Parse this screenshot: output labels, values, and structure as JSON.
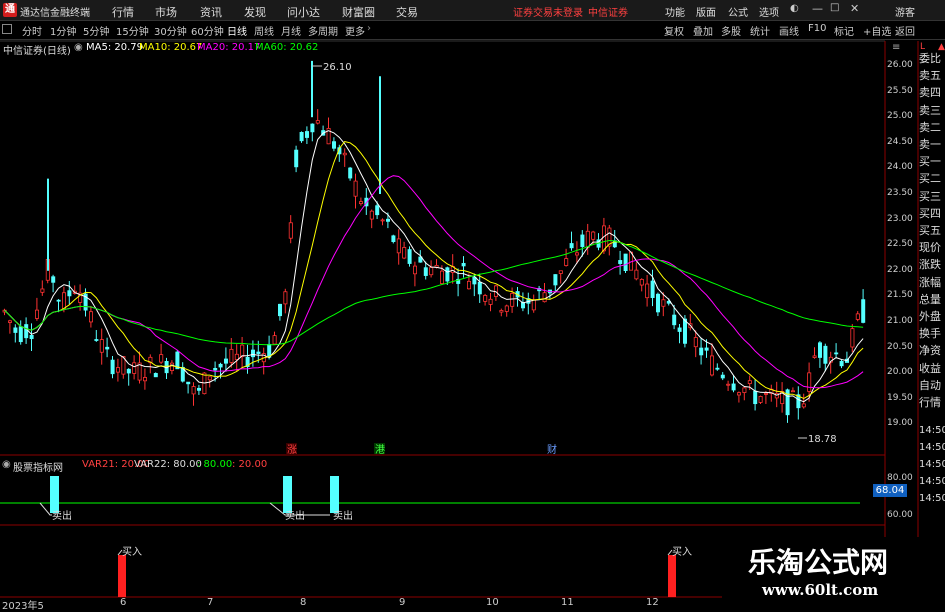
{
  "titlebar": {
    "app_title": "通达信金融终端",
    "menu": [
      "行情",
      "市场",
      "资讯",
      "发现",
      "问小达",
      "财富圈",
      "交易"
    ],
    "notice_login": "证券交易未登录",
    "notice_broker": "中信证券",
    "right_menu": [
      "功能",
      "版面",
      "公式",
      "选项"
    ],
    "guest": "游客"
  },
  "toolbar": {
    "periods": [
      "分时",
      "1分钟",
      "5分钟",
      "15分钟",
      "30分钟",
      "60分钟",
      "日线",
      "周线",
      "月线",
      "多周期",
      "更多"
    ],
    "active_period": "日线",
    "right_buttons": [
      "复权",
      "叠加",
      "多股",
      "统计",
      "画线",
      "F10",
      "标记",
      "+自选",
      "返回"
    ]
  },
  "legend": {
    "stock": "中信证券(日线)",
    "ma5": "MA5: 20.79",
    "ma10": "MA10: 20.67",
    "ma20": "MA20: 20.17",
    "ma60": "MA60: 20.62",
    "more": "≡"
  },
  "annotations": {
    "high": "26.10",
    "low": "18.78"
  },
  "event_markers": [
    "涨",
    "港",
    "财"
  ],
  "price_axis": [
    "26.00",
    "25.50",
    "25.00",
    "24.50",
    "24.00",
    "23.50",
    "23.00",
    "22.50",
    "22.00",
    "21.50",
    "21.00",
    "20.50",
    "20.00",
    "19.50",
    "19.00"
  ],
  "right_panel": [
    "委比",
    "卖五",
    "卖四",
    "卖三",
    "卖二",
    "卖一",
    "买一",
    "买二",
    "买三",
    "买四",
    "买五",
    "现价",
    "涨跌",
    "涨幅",
    "总量",
    "外盘",
    "换手",
    "净资",
    "收益",
    "自动",
    "行情"
  ],
  "right_times": [
    "14:50",
    "14:50",
    "14:50",
    "14:50",
    "14:50"
  ],
  "indicator": {
    "name": "股票指标网",
    "var21": "VAR21: 20.00",
    "var22": "VAR22: 80.00",
    "val80": ": 80.00",
    "val20": ": 20.00",
    "sell_label": "卖出",
    "buy_label": "买入",
    "axis_top": "80.00",
    "current": "68.04",
    "axis_bottom": "60.00"
  },
  "dates": [
    "2023年5",
    "6",
    "7",
    "8",
    "9",
    "10",
    "11",
    "12"
  ],
  "watermark": {
    "title": "乐淘公式网",
    "url": "www.60lt.com"
  },
  "colors": {
    "up": "#ff3232",
    "down": "#54ffff",
    "ma5": "#ffffff",
    "ma10": "#ffff00",
    "ma20": "#ff00ff",
    "ma60": "#00ff00"
  }
}
